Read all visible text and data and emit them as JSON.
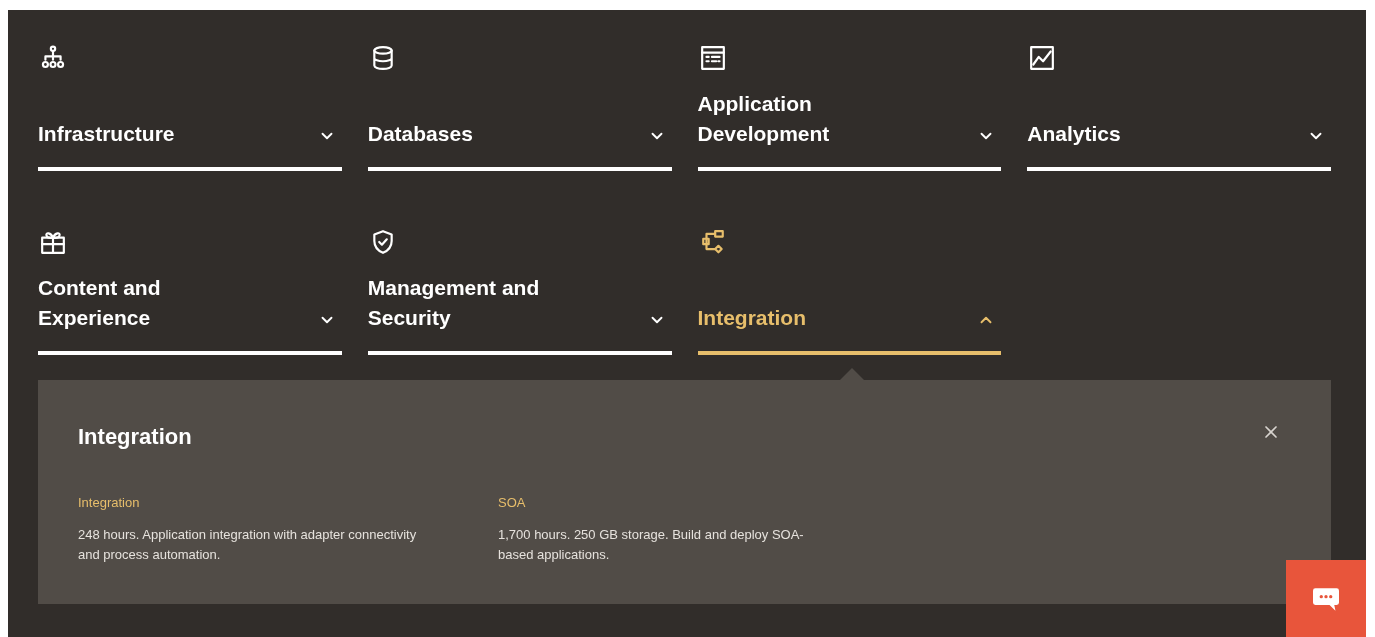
{
  "categories": [
    {
      "title": "Infrastructure",
      "expanded": false
    },
    {
      "title": "Databases",
      "expanded": false
    },
    {
      "title": "Application Development",
      "expanded": false
    },
    {
      "title": "Analytics",
      "expanded": false
    },
    {
      "title": "Content and Experience",
      "expanded": false
    },
    {
      "title": "Management and Security",
      "expanded": false
    },
    {
      "title": "Integration",
      "expanded": true
    }
  ],
  "detail": {
    "title": "Integration",
    "items": [
      {
        "name": "Integration",
        "description": "248 hours. Application integration with adapter connectivity and process automation."
      },
      {
        "name": "SOA",
        "description": "1,700 hours. 250 GB storage. Build and deploy SOA-based applications."
      }
    ]
  }
}
